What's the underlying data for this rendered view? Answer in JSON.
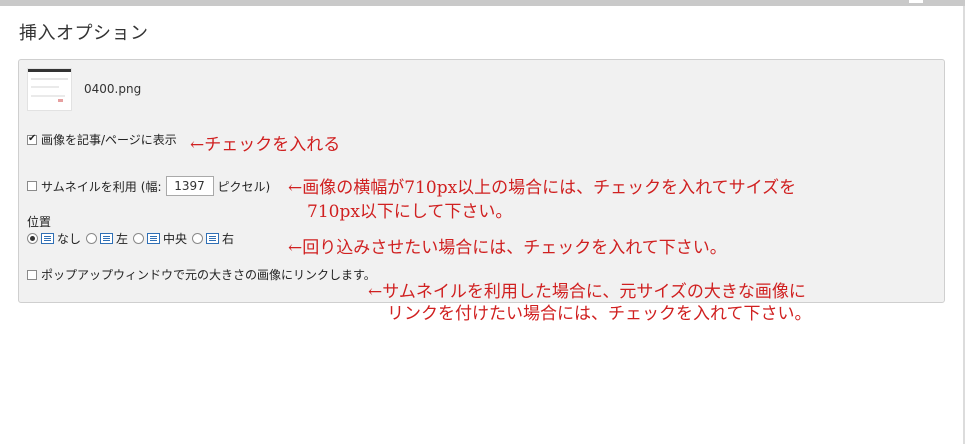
{
  "dialog": {
    "title": "挿入オプション"
  },
  "file": {
    "name": "0400.png"
  },
  "options": {
    "show_image_label": "画像を記事/ページに表示",
    "show_image_checked": true,
    "thumbnail_label": "サムネイルを利用",
    "width_prefix": "(幅:",
    "width_value": "1397",
    "width_suffix": "ピクセル)",
    "thumbnail_checked": false,
    "position_label": "位置",
    "positions": [
      {
        "label": "なし",
        "selected": true
      },
      {
        "label": "左",
        "selected": false
      },
      {
        "label": "中央",
        "selected": false
      },
      {
        "label": "右",
        "selected": false
      }
    ],
    "popup_label": "ポップアップウィンドウで元の大きさの画像にリンクします。",
    "popup_checked": false
  },
  "annotations": {
    "a1": "←チェックを入れる",
    "a2_line1": "←画像の横幅が710px以上の場合には、チェックを入れてサイズを",
    "a2_line2": "710px以下にして下さい。",
    "a3": "←回り込みさせたい場合には、チェックを入れて下さい。",
    "a4_line1": "←サムネイルを利用した場合に、元サイズの大きな画像に",
    "a4_line2": "リンクを付けたい場合には、チェックを入れて下さい。"
  },
  "colors": {
    "annotation": "#d02020",
    "panel": "#f1f1f1",
    "icon": "#2f6fb5"
  }
}
